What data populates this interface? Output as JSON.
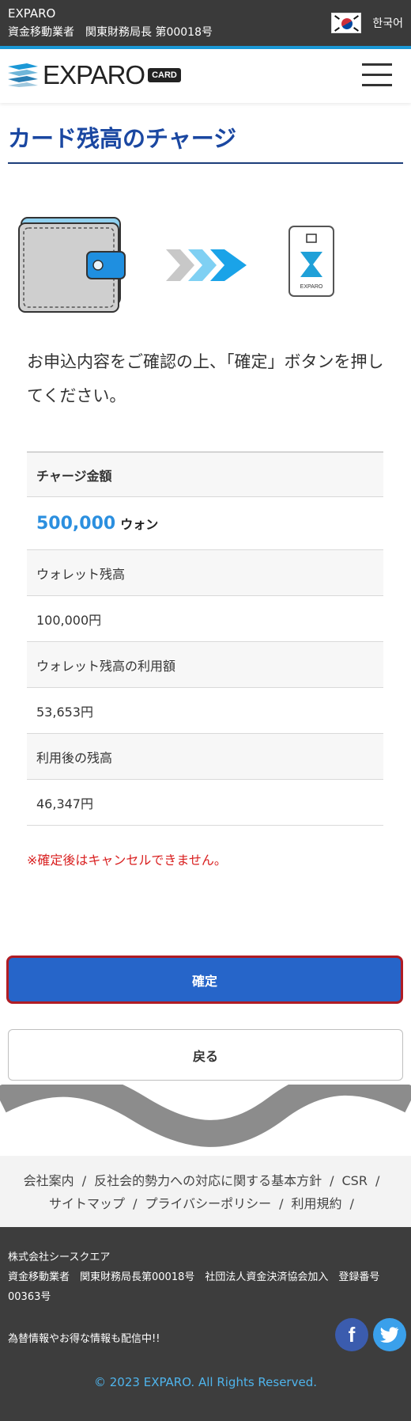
{
  "topbar": {
    "brand": "EXPARO",
    "license": "資金移動業者　関東財務局長 第00018号",
    "language": "한국어"
  },
  "header": {
    "logo_text": "EXPARO",
    "logo_badge": "CARD"
  },
  "page": {
    "title": "カード残高のチャージ",
    "illustration_card_label": "EXPARO",
    "confirm_message": "お申込内容をご確認の上、「確定」ボタンを押してください。",
    "warning": "※確定後はキャンセルできません。"
  },
  "summary": {
    "charge_label": "チャージ金額",
    "charge_amount": "500,000",
    "charge_unit": "ウォン",
    "wallet_balance_label": "ウォレット残高",
    "wallet_balance_value": "100,000円",
    "wallet_used_label": "ウォレット残高の利用額",
    "wallet_used_value": "53,653円",
    "after_balance_label": "利用後の残高",
    "after_balance_value": "46,347円"
  },
  "buttons": {
    "confirm": "確定",
    "back": "戻る"
  },
  "footer_links": {
    "company": "会社案内",
    "antisocial": "反社会的勢力への対応に関する基本方針",
    "csr": "CSR",
    "sitemap": "サイトマップ",
    "privacy": "プライバシーポリシー",
    "terms": "利用規約",
    "separator": "/"
  },
  "footer": {
    "company_name": "株式会社シースクエア",
    "registration": "資金移動業者　関東財務局長第00018号　社団法人資金決済協会加入　登録番号00363号",
    "promo": "為替情報やお得な情報も配信中!!",
    "copyright": "© 2023 EXPARO. All Rights Reserved.",
    "sns": [
      "facebook-icon",
      "twitter-icon"
    ]
  },
  "colors": {
    "accent": "#2665c9",
    "title": "#1a47a1",
    "amount": "#2b8fdf",
    "warning": "#d92020",
    "focus_border": "#b01c24"
  }
}
